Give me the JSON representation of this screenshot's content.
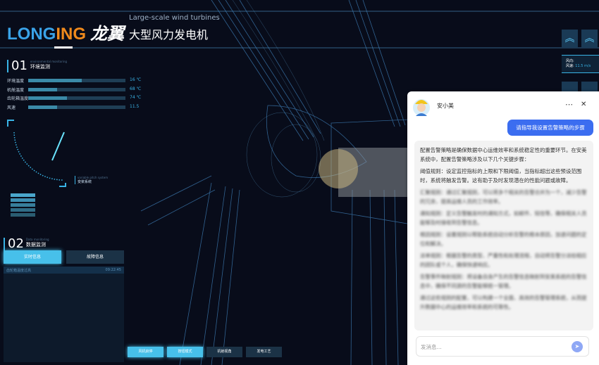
{
  "header": {
    "logo_a": "LONG",
    "logo_b": "ING",
    "logo_c": "龙翼",
    "subtitle": "Large-scale wind turbines",
    "title": "大型风力发电机"
  },
  "env": {
    "num": "01",
    "en": "environmental monitoring",
    "title": "环境监测",
    "rows": [
      {
        "label": "环境温度",
        "value": "16 ℃",
        "fill": 0.55
      },
      {
        "label": "机舱温度",
        "value": "68 ℃",
        "fill": 0.3
      },
      {
        "label": "齿轮箱温度",
        "value": "74 ℃",
        "fill": 0.4
      },
      {
        "label": "风速",
        "value": "11.5",
        "fill": 0.3
      }
    ]
  },
  "pitch": {
    "en": "variable pitch system",
    "title": "变桨系统"
  },
  "data": {
    "num": "02",
    "en": "Data monitoring",
    "title": "数据监测",
    "tabs": [
      "实时信息",
      "故障信息"
    ],
    "active_tab": 0,
    "row": {
      "text": "齿轮箱温度过高",
      "time": "09:22:45"
    }
  },
  "bottom_buttons": [
    {
      "label": "风机启停",
      "active": true
    },
    {
      "label": "按钮模式",
      "active": true
    },
    {
      "label": "机舱视角",
      "active": false
    },
    {
      "label": "发电工艺",
      "active": false
    }
  ],
  "wind": {
    "dir_label": "风向:",
    "speed_label": "风速:",
    "speed": "11.5",
    "unit": "m/s"
  },
  "chat": {
    "name": "安小美",
    "more": "⋯",
    "close": "✕",
    "user_msg": "请指导我设置告警策略的步骤",
    "reply": [
      "配置告警策略是确保数据中心运维效率和系统稳定性的重要环节。在安美系统中，配置告警策略涉及以下几个关键步骤：",
      "阈值规则：设定监控指标的上限和下限阈值，当指标超出这些预设范围时，系统将触发告警。这有助于及时发现潜在的性能问题或故障。",
      "汇聚规则：通过汇聚规则，可以将多个相关的告警合并为一个，减少告警的冗余，提高运维人员的工作效率。",
      "通知规则：定义告警触发时的通知方式，如邮件、短信等，确保相关人员能够及时接收到告警信息。",
      "根因规则：设置规则以帮助系统自动分析告警的根本原因，加速问题的定位和解决。",
      "派单规则：根据告警的类型、严重性和处理流程，自动将告警分派给相应的团队或个人，确保快速响应。",
      "告警事件映射规则：将设备自身产生的告警信息映射到安美系统的告警信息中，确保不同源的告警能够统一管理。",
      "通过这些规则的配置，可以构建一个全面、高效的告警管理系统，从而提升数据中心的运维效率和系统的可靠性。"
    ],
    "input_placeholder": "发消息...",
    "colors": {
      "user_bubble": "#3b6df0",
      "send": "#8fa8f5"
    }
  }
}
